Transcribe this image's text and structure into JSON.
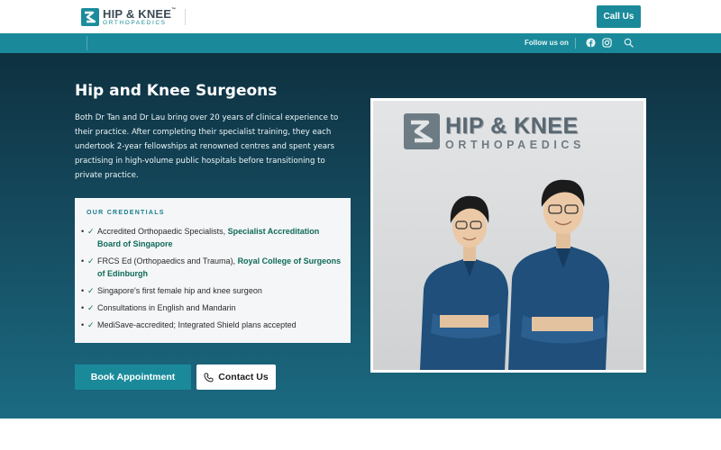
{
  "header": {
    "logo_title": "HIP & KNEE",
    "logo_tm": "™",
    "logo_sub": "ORTHOPAEDICS",
    "call_label": "Call Us"
  },
  "strip": {
    "follow_label": "Follow us on",
    "icons": [
      "facebook-icon",
      "instagram-icon",
      "search-icon"
    ]
  },
  "hero": {
    "title": "Hip and Knee Surgeons",
    "description": "Both Dr Tan and Dr Lau bring over 20 years of clinical experience to their practice. After completing their specialist training, they each undertook 2-year fellowships at renowned centres and spent years practising in high-volume public hospitals before transitioning to private practice.",
    "credentials_label": "OUR CREDENTIALS",
    "credentials": [
      {
        "text": "Accredited Orthopaedic Specialists, ",
        "bold": "Specialist Accreditation Board of Singapore"
      },
      {
        "text": "FRCS Ed (Orthopaedics and Trauma), ",
        "bold": "Royal College of Surgeons of Edinburgh"
      },
      {
        "text": "Singapore's first female hip and knee surgeon",
        "bold": ""
      },
      {
        "text": "Consultations in English and Mandarin",
        "bold": ""
      },
      {
        "text": "MediSave-accredited; Integrated Shield plans accepted",
        "bold": ""
      }
    ],
    "book_label": "Book Appointment",
    "contact_label": "Contact Us",
    "photo_wall_title": "HIP & KNEE",
    "photo_wall_sub": "ORTHOPAEDICS"
  },
  "colors": {
    "brand_teal": "#1a8a9a",
    "hero_dark": "#0e3140",
    "credential_bold": "#0f6a5a"
  }
}
